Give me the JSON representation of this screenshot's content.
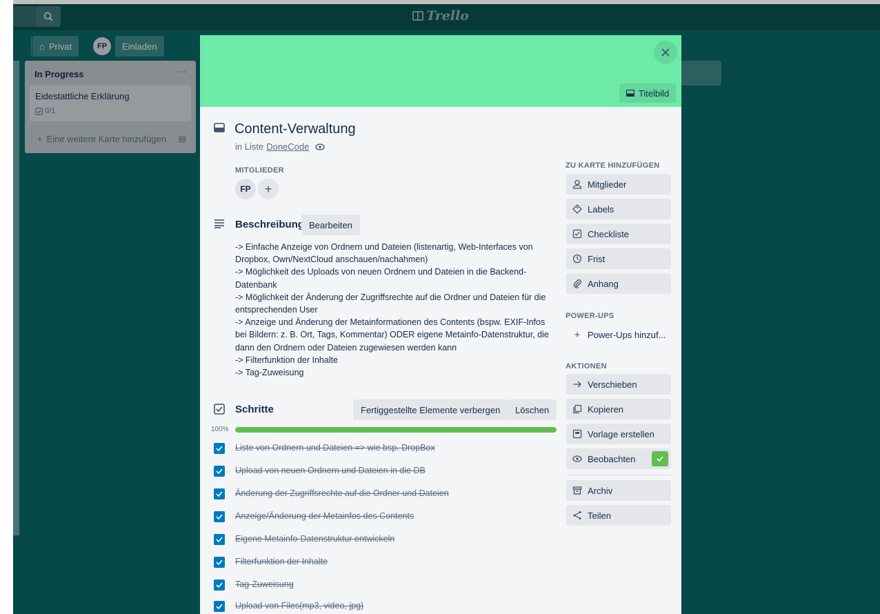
{
  "app": {
    "logo_text": "Trello"
  },
  "board_header": {
    "visibility_label": "Privat",
    "member_initials": "FP",
    "invite_label": "Einladen"
  },
  "list": {
    "title": "In Progress",
    "menu": "···",
    "card_title": "Eidestattliche Erklärung",
    "card_badge": "0/1",
    "add_card_label": "Eine weitere Karte hinzufügen"
  },
  "modal": {
    "cover_button": "Titelbild",
    "card_title": "Content-Verwaltung",
    "in_list_prefix": "in Liste",
    "list_name": "DoneCode",
    "members_label": "MITGLIEDER",
    "member_initials": "FP",
    "description": {
      "title": "Beschreibung",
      "edit_label": "Bearbeiten",
      "lines": [
        "-> Einfache Anzeige von Ordnern und Dateien (listenartig, Web-Interfaces von",
        "Dropbox, Own/NextCloud anschauen/nachahmen)",
        "-> Möglichkeit des Uploads von neuen Ordnern und Dateien in die Backend-",
        "Datenbank",
        "-> Möglichkeit der Änderung der Zugriffsrechte auf die Ordner und Dateien für die",
        "entsprechenden User",
        "-> Anzeige und Änderung der Metainformationen des Contents (bspw. EXIF-Infos",
        "bei Bildern: z. B. Ort, Tags, Kommentar) ODER eigene Metainfo-Datenstruktur, die",
        "dann den Ordnern oder Dateien zugewiesen werden kann",
        "-> Filterfunktion der Inhalte",
        "-> Tag-Zuweisung"
      ]
    },
    "checklist": {
      "title": "Schritte",
      "hide_label": "Fertiggestellte Elemente verbergen",
      "delete_label": "Löschen",
      "percent_text": "100%",
      "progress": 1.0,
      "items": [
        "Liste von Ordnern und Dateien => wie bsp. DropBox",
        "Upload von neuen Ordnern und Dateien in die DB",
        "Änderung der Zugriffsrechte auf die Ordner und Dateien",
        "Anzeige/Änderung der Metainfos des Contents",
        "Eigene Metainfo-Datenstruktur entwickeln",
        "Filterfunktion der Inhalte",
        "Tag-Zuweisung",
        "Upload von Files(mp3, video, jpg)"
      ]
    },
    "sidebar": {
      "add_label": "ZU KARTE HINZUFÜGEN",
      "add_items": [
        "Mitglieder",
        "Labels",
        "Checkliste",
        "Frist",
        "Anhang"
      ],
      "powerups_label": "POWER-UPS",
      "powerups_add": "Power-Ups hinzuf...",
      "actions_label": "AKTIONEN",
      "actions": [
        "Verschieben",
        "Kopieren",
        "Vorlage erstellen",
        "Beobachten",
        "Archiv",
        "Teilen"
      ]
    }
  },
  "colors": {
    "board_bg": "#0a6161",
    "cover": "#6deaa8",
    "checkbox": "#0079bf",
    "progress": "#61bd4f"
  }
}
